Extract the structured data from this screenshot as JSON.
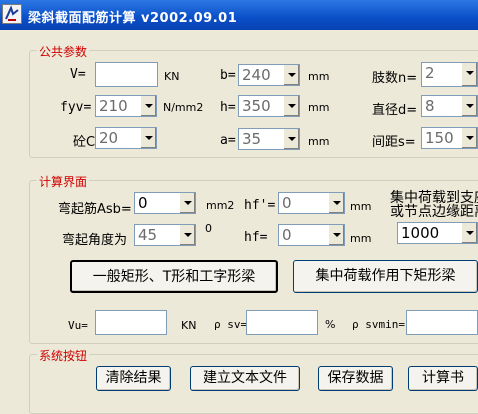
{
  "window": {
    "title": "梁斜截面配筋计算 v2002.09.01"
  },
  "groups": {
    "common": "公共参数",
    "calc": "计算界面",
    "system": "系统按钮"
  },
  "common": {
    "v": {
      "label": "V=",
      "value": "",
      "unit": "KN"
    },
    "b": {
      "label": "b=",
      "value": "240",
      "unit": "mm"
    },
    "legs": {
      "label": "肢数n=",
      "value": "2"
    },
    "fyv": {
      "label": "fyv=",
      "value": "210",
      "unit": "N/mm2"
    },
    "h": {
      "label": "h=",
      "value": "350",
      "unit": "mm"
    },
    "diameter": {
      "label": "直径d=",
      "value": "8"
    },
    "concrete": {
      "label": "砼C",
      "value": "20"
    },
    "a": {
      "label": "a=",
      "value": "35",
      "unit": "mm"
    },
    "spacing": {
      "label": "间距s=",
      "value": "150"
    }
  },
  "calc": {
    "asb": {
      "label": "弯起筋Asb=",
      "value": "0",
      "unit": "mm2"
    },
    "hf_prime": {
      "label": "hf'=",
      "value": "0",
      "unit": "mm"
    },
    "angle": {
      "label": "弯起角度为",
      "value": "45",
      "unit": "0"
    },
    "hf": {
      "label": "hf=",
      "value": "0",
      "unit": "mm"
    },
    "distance_label_1": "集中荷载到支座",
    "distance_label_2": "或节点边缘距离",
    "distance_value": "1000",
    "button_general": "一般矩形、T形和工字形梁",
    "button_concentrated": "集中荷载作用下矩形梁",
    "vu": {
      "label": "Vu=",
      "value": "",
      "unit": "KN"
    },
    "rho_sv": {
      "label": "ρ sv=",
      "value": "",
      "unit": "%"
    },
    "rho_svmin": {
      "label": "ρ svmin=",
      "value": ""
    }
  },
  "system": {
    "clear": "清除结果",
    "build_text": "建立文本文件",
    "save": "保存数据",
    "calc_book": "计算书"
  }
}
